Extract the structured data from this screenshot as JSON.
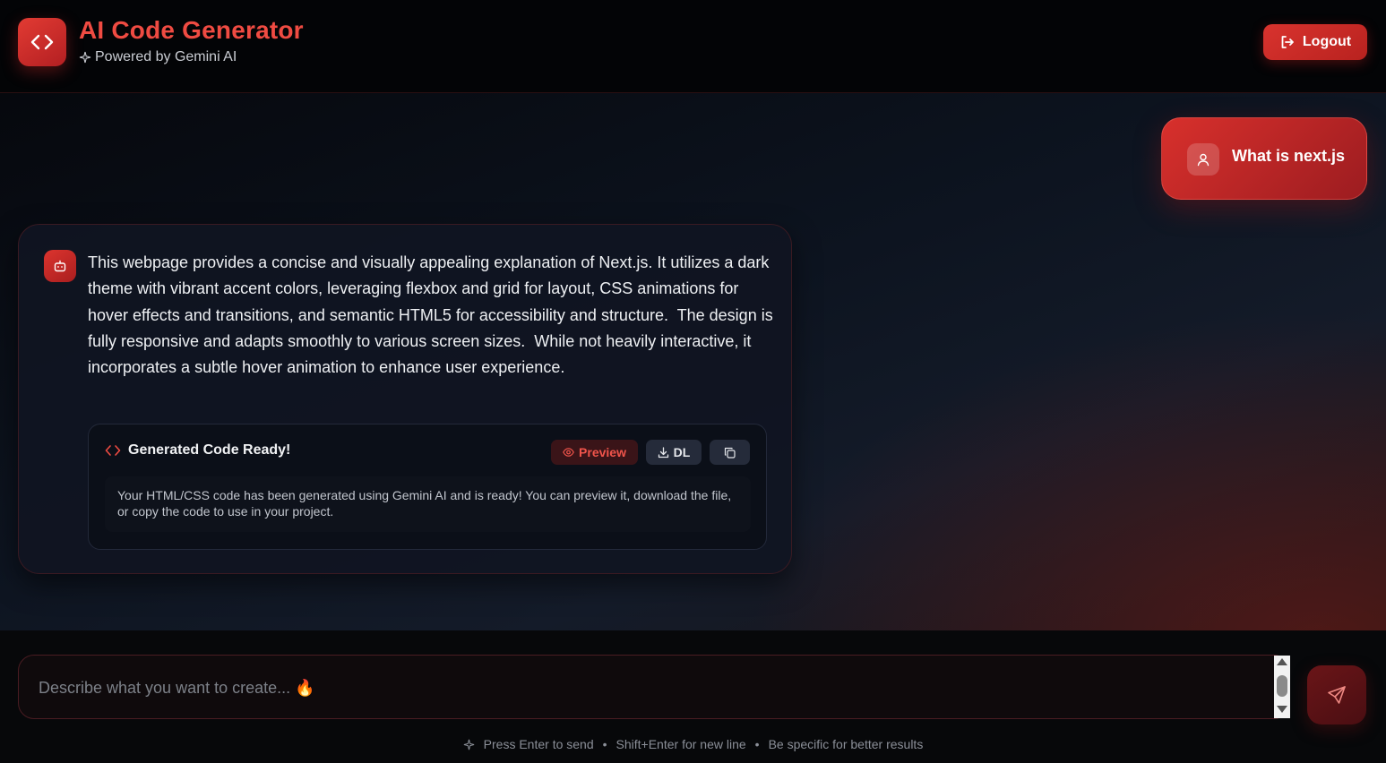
{
  "header": {
    "title": "AI Code Generator",
    "subtitle": "Powered by Gemini AI",
    "logout_label": "Logout",
    "logo_icon": "code-brackets-icon"
  },
  "chat": {
    "user_message": "What is next.js",
    "bot_message": "This webpage provides a concise and visually appealing explanation of Next.js. It utilizes a dark theme with vibrant accent colors, leveraging flexbox and grid for layout, CSS animations for hover effects and transitions, and semantic HTML5 for accessibility and structure.  The design is fully responsive and adapts smoothly to various screen sizes.  While not heavily interactive, it incorporates a subtle hover animation to enhance user experience.",
    "code_panel": {
      "title": "Generated Code Ready!",
      "preview_label": "Preview",
      "download_label": "DL",
      "description": "Your HTML/CSS code has been generated using Gemini AI and is ready! You can preview it, download the file, or copy the code to use in your project."
    }
  },
  "input": {
    "placeholder": "Describe what you want to create... 🔥",
    "value": ""
  },
  "hints": {
    "send": "Press Enter to send",
    "newline": "Shift+Enter for new line",
    "tip": "Be specific for better results"
  },
  "colors": {
    "accent": "#ef4b42",
    "accent_dark": "#b31f22",
    "background": "#05070b"
  }
}
